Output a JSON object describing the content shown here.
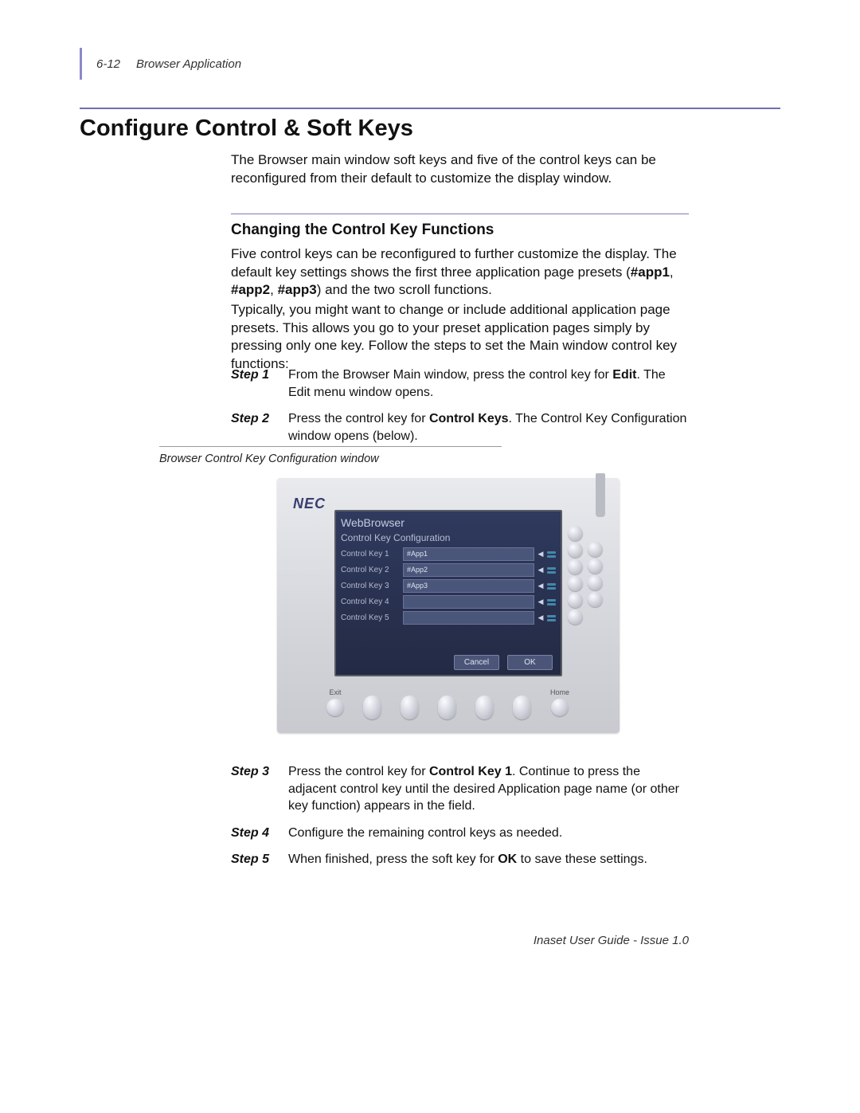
{
  "header": {
    "page_ref": "6-12",
    "chapter": "Browser Application"
  },
  "h1": "Configure Control & Soft Keys",
  "intro": "The Browser main window soft keys and five of the control keys can be reconfigured from their default to customize the display window.",
  "h2": "Changing the Control Key Functions",
  "para1_pre": "Five control keys can be reconfigured to further customize the display. The default key settings shows the first three application page presets (",
  "para1_b1": "#app1",
  "para1_sep1": ", ",
  "para1_b2": "#app2",
  "para1_sep2": ", ",
  "para1_b3": "#app3",
  "para1_post": ") and the two scroll functions.",
  "para2": "Typically, you might want to change or include additional application page presets. This allows you go to your preset application pages simply by pressing only one key. Follow the steps to set the Main window control key functions:",
  "steps_top": [
    {
      "label": "Step 1",
      "pre": "From the Browser Main window, press the control key for ",
      "bold": "Edit",
      "post": ". The Edit menu window opens."
    },
    {
      "label": "Step 2",
      "pre": "Press the control key for ",
      "bold": "Control Keys",
      "post": ". The Control Key Configuration window opens (below)."
    }
  ],
  "figure_caption": "Browser Control Key Configuration window",
  "device": {
    "brand": "NEC",
    "screen_title": "WebBrowser",
    "screen_subtitle": "Control Key Configuration",
    "rows": [
      {
        "label": "Control Key 1",
        "value": "#App1"
      },
      {
        "label": "Control Key 2",
        "value": "#App2"
      },
      {
        "label": "Control Key 3",
        "value": "#App3"
      },
      {
        "label": "Control Key 4",
        "value": ""
      },
      {
        "label": "Control Key 5",
        "value": ""
      }
    ],
    "buttons": {
      "cancel": "Cancel",
      "ok": "OK"
    },
    "bottom_labels": {
      "exit": "Exit",
      "home": "Home"
    }
  },
  "steps_bottom": [
    {
      "label": "Step 3",
      "pre": "Press the control key for ",
      "bold": "Control Key 1",
      "post": ". Continue to press the adjacent control key until the desired Application page name (or other key function) appears in the field."
    },
    {
      "label": "Step 4",
      "pre": "Configure the remaining control keys as needed.",
      "bold": "",
      "post": ""
    },
    {
      "label": "Step 5",
      "pre": "When finished, press the soft key for ",
      "bold": "OK",
      "post": " to save these settings."
    }
  ],
  "footer": "Inaset User Guide - Issue 1.0"
}
